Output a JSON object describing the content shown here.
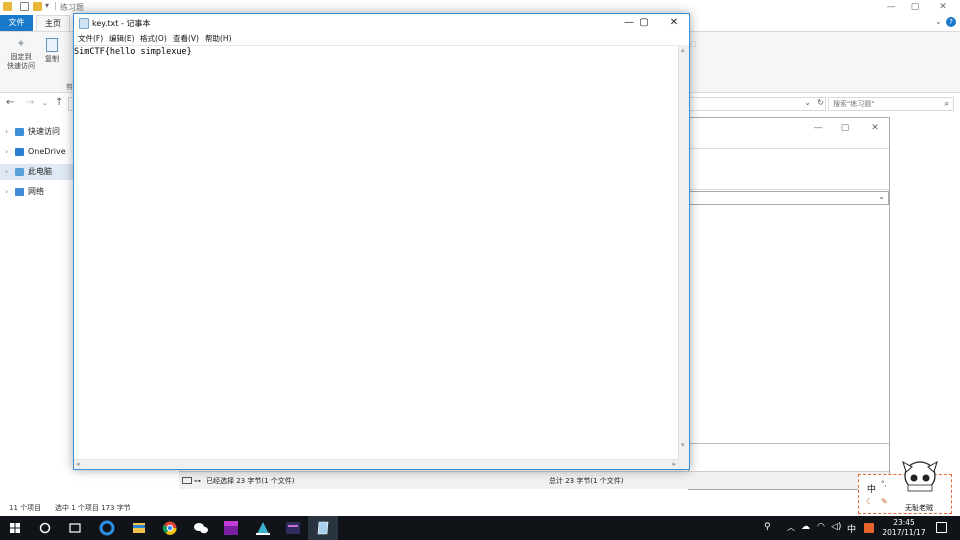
{
  "explorer": {
    "title": "练习题",
    "tabs": {
      "file": "文件",
      "home": "主页"
    },
    "help": "?",
    "ribbon": {
      "pin": [
        "固定到",
        "快速访问"
      ],
      "copy": "复制",
      "clip_fragment": "剪"
    },
    "search_placeholder": "搜索\"练习题\"",
    "sidebar": [
      {
        "label": "快速访问",
        "color": "#3b8fd8"
      },
      {
        "label": "OneDrive",
        "color": "#2b7cd3"
      },
      {
        "label": "此电脑",
        "color": "#5aa0d9"
      },
      {
        "label": "网络",
        "color": "#3d8ad6"
      }
    ],
    "status": {
      "items": "11 个项目",
      "selected": "选中 1 个项目  173 字节"
    }
  },
  "dialog2": {
    "status_left": "已经选择 23 字节(1 个文件)",
    "status_right": "总计 23 字节(1 个文件)"
  },
  "notepad": {
    "title": "key.txt - 记事本",
    "menu": [
      "文件(F)",
      "编辑(E)",
      "格式(O)",
      "查看(V)",
      "帮助(H)"
    ],
    "content": "SimCTF{hello simplexue}"
  },
  "mascot": {
    "lang": "中",
    "caption": "无耻老贼"
  },
  "taskbar": {
    "ime": "中",
    "time": "23:45",
    "date": "2017/11/17"
  },
  "colors": {
    "accent": "#1979ca",
    "taskbar": "#101418",
    "notepad_border": "#3a8fd9"
  }
}
